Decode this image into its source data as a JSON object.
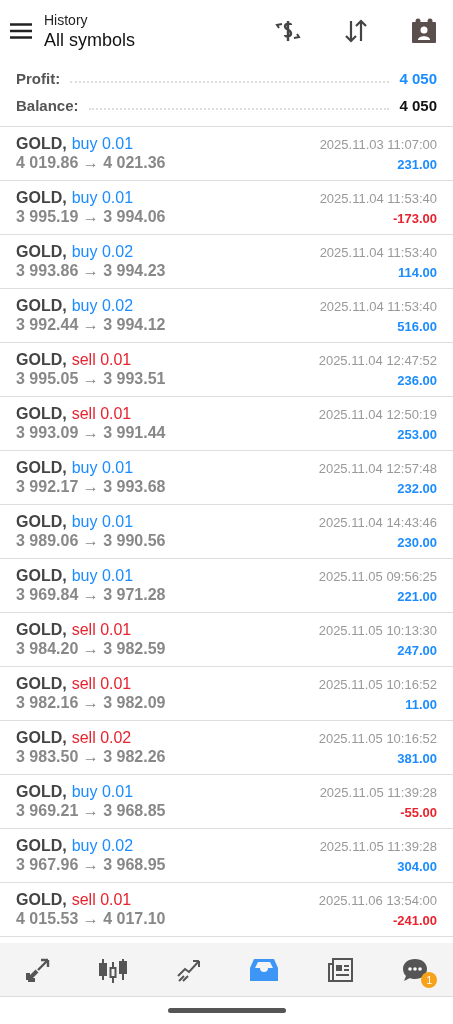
{
  "header": {
    "subtitle": "History",
    "title": "All symbols"
  },
  "summary": [
    {
      "label": "Profit:",
      "value": "4 050",
      "kind": "accent"
    },
    {
      "label": "Balance:",
      "value": "4 050",
      "kind": "plain"
    }
  ],
  "trades": [
    {
      "symbol": "GOLD,",
      "order": {
        "text": "buy 0.01",
        "kind": "buy"
      },
      "prices": "4 019.86 → 4 021.36",
      "time": "2025.11.03 11:07:00",
      "profit": {
        "text": "231.00",
        "kind": "gain"
      }
    },
    {
      "symbol": "GOLD,",
      "order": {
        "text": "buy 0.01",
        "kind": "buy"
      },
      "prices": "3 995.19 → 3 994.06",
      "time": "2025.11.04 11:53:40",
      "profit": {
        "text": "-173.00",
        "kind": "loss"
      }
    },
    {
      "symbol": "GOLD,",
      "order": {
        "text": "buy 0.02",
        "kind": "buy"
      },
      "prices": "3 993.86 → 3 994.23",
      "time": "2025.11.04 11:53:40",
      "profit": {
        "text": "114.00",
        "kind": "gain"
      }
    },
    {
      "symbol": "GOLD,",
      "order": {
        "text": "buy 0.02",
        "kind": "buy"
      },
      "prices": "3 992.44 → 3 994.12",
      "time": "2025.11.04 11:53:40",
      "profit": {
        "text": "516.00",
        "kind": "gain"
      }
    },
    {
      "symbol": "GOLD,",
      "order": {
        "text": "sell 0.01",
        "kind": "sell"
      },
      "prices": "3 995.05 → 3 993.51",
      "time": "2025.11.04 12:47:52",
      "profit": {
        "text": "236.00",
        "kind": "gain"
      }
    },
    {
      "symbol": "GOLD,",
      "order": {
        "text": "sell 0.01",
        "kind": "sell"
      },
      "prices": "3 993.09 → 3 991.44",
      "time": "2025.11.04 12:50:19",
      "profit": {
        "text": "253.00",
        "kind": "gain"
      }
    },
    {
      "symbol": "GOLD,",
      "order": {
        "text": "buy 0.01",
        "kind": "buy"
      },
      "prices": "3 992.17 → 3 993.68",
      "time": "2025.11.04 12:57:48",
      "profit": {
        "text": "232.00",
        "kind": "gain"
      }
    },
    {
      "symbol": "GOLD,",
      "order": {
        "text": "buy 0.01",
        "kind": "buy"
      },
      "prices": "3 989.06 → 3 990.56",
      "time": "2025.11.04 14:43:46",
      "profit": {
        "text": "230.00",
        "kind": "gain"
      }
    },
    {
      "symbol": "GOLD,",
      "order": {
        "text": "buy 0.01",
        "kind": "buy"
      },
      "prices": "3 969.84 → 3 971.28",
      "time": "2025.11.05 09:56:25",
      "profit": {
        "text": "221.00",
        "kind": "gain"
      }
    },
    {
      "symbol": "GOLD,",
      "order": {
        "text": "sell 0.01",
        "kind": "sell"
      },
      "prices": "3 984.20 → 3 982.59",
      "time": "2025.11.05 10:13:30",
      "profit": {
        "text": "247.00",
        "kind": "gain"
      }
    },
    {
      "symbol": "GOLD,",
      "order": {
        "text": "sell 0.01",
        "kind": "sell"
      },
      "prices": "3 982.16 → 3 982.09",
      "time": "2025.11.05 10:16:52",
      "profit": {
        "text": "11.00",
        "kind": "gain"
      }
    },
    {
      "symbol": "GOLD,",
      "order": {
        "text": "sell 0.02",
        "kind": "sell"
      },
      "prices": "3 983.50 → 3 982.26",
      "time": "2025.11.05 10:16:52",
      "profit": {
        "text": "381.00",
        "kind": "gain"
      }
    },
    {
      "symbol": "GOLD,",
      "order": {
        "text": "buy 0.01",
        "kind": "buy"
      },
      "prices": "3 969.21 → 3 968.85",
      "time": "2025.11.05 11:39:28",
      "profit": {
        "text": "-55.00",
        "kind": "loss"
      }
    },
    {
      "symbol": "GOLD,",
      "order": {
        "text": "buy 0.02",
        "kind": "buy"
      },
      "prices": "3 967.96 → 3 968.95",
      "time": "2025.11.05 11:39:28",
      "profit": {
        "text": "304.00",
        "kind": "gain"
      }
    },
    {
      "symbol": "GOLD,",
      "order": {
        "text": "sell 0.01",
        "kind": "sell"
      },
      "prices": "4 015.53 → 4 017.10",
      "time": "2025.11.06 13:54:00",
      "profit": {
        "text": "-241.00",
        "kind": "loss"
      }
    }
  ],
  "nav": [
    {
      "kind": "quotes",
      "selected": false
    },
    {
      "kind": "chart",
      "selected": false
    },
    {
      "kind": "trade",
      "selected": false
    },
    {
      "kind": "history",
      "selected": true
    },
    {
      "kind": "news",
      "selected": false
    },
    {
      "kind": "chat",
      "selected": false,
      "badge": "1"
    }
  ]
}
